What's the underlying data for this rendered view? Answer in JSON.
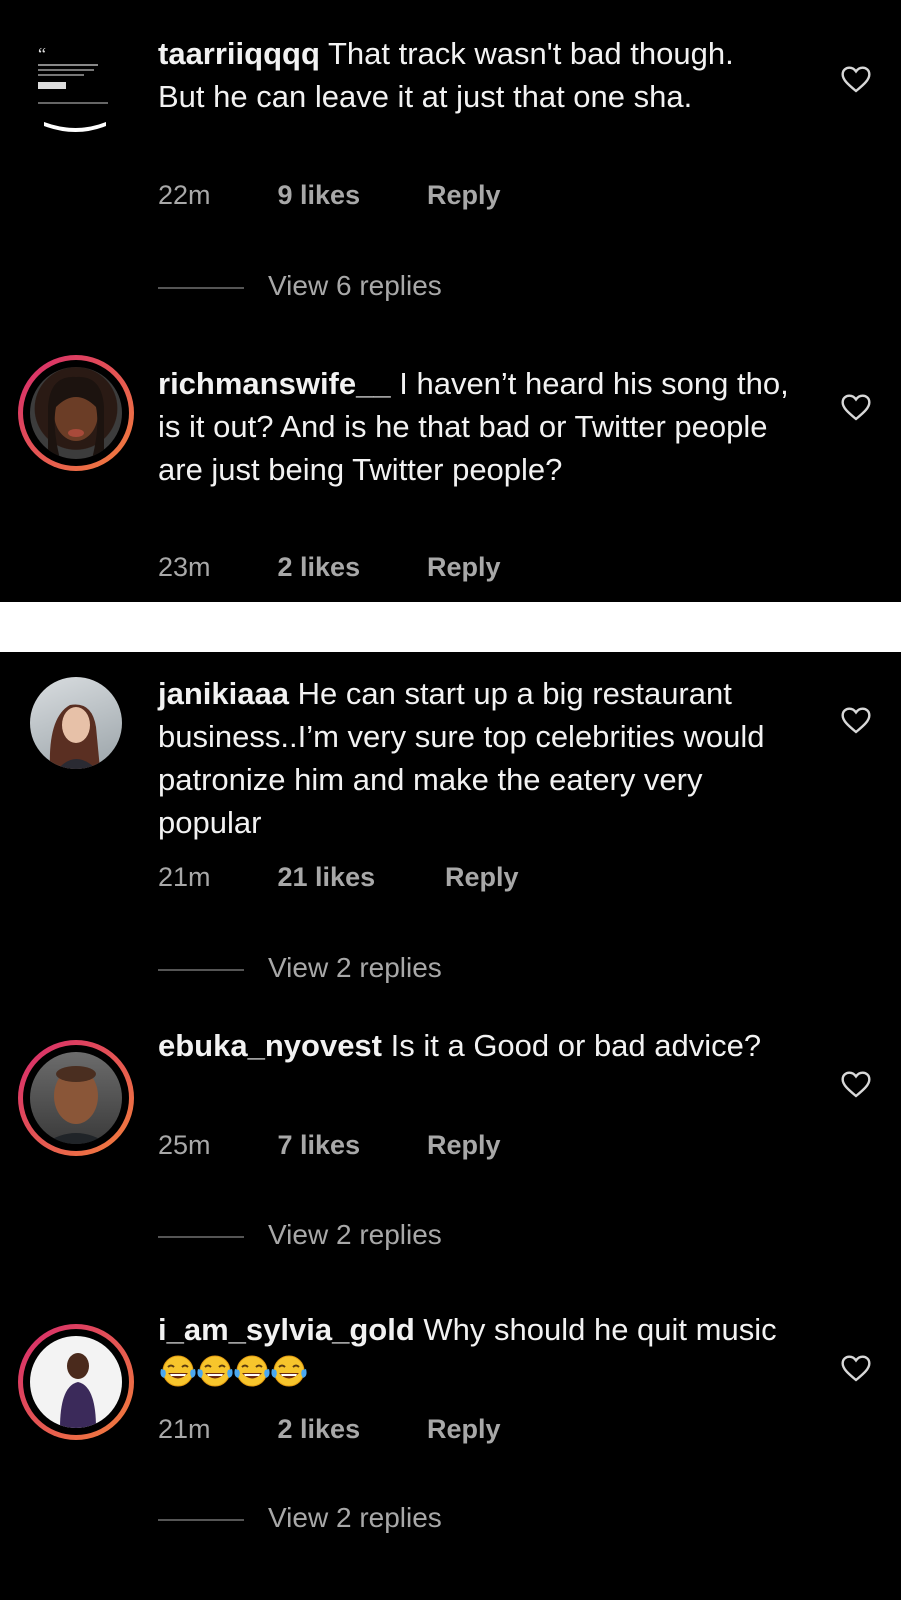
{
  "comments": [
    {
      "username": "taarriiqqqq",
      "text": "That track wasn't bad though.",
      "text_line2": "But he can leave it at just that one sha.",
      "time": "22m",
      "likes": "9 likes",
      "reply": "Reply",
      "view_replies": "View 6 replies"
    },
    {
      "username": "richmanswife__",
      "text": "I haven’t heard his song tho, is it out? And is he that bad or Twitter people are just being Twitter people?",
      "time": "23m",
      "likes": "2 likes",
      "reply": "Reply"
    },
    {
      "username": "janikiaaa",
      "text": "He can start up a big restaurant business..I’m very sure top celebrities would patronize him and make the eatery very popular",
      "time": "21m",
      "likes": "21 likes",
      "reply": "Reply",
      "view_replies": "View 2 replies"
    },
    {
      "username": "ebuka_nyovest",
      "text": "Is it a Good or bad advice?",
      "time": "25m",
      "likes": "7 likes",
      "reply": "Reply",
      "view_replies": "View 2 replies"
    },
    {
      "username": "i_am_sylvia_gold",
      "text": "Why should he quit music",
      "emoji_count": 4,
      "emoji_name": "face-with-tears-of-joy",
      "time": "21m",
      "likes": "2 likes",
      "reply": "Reply",
      "view_replies": "View 2 replies"
    }
  ],
  "colors": {
    "background": "#000000",
    "text": "#f2f2f2",
    "meta": "#a8a8a8",
    "story_ring_start": "#d6286e",
    "story_ring_end": "#f3813a",
    "divider": "#ffffff"
  }
}
